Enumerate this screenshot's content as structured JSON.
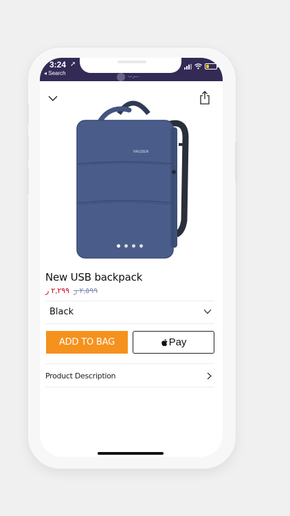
{
  "status_bar": {
    "time": "3:24",
    "back_label": "◂ Search",
    "brand_text": "ـــرب"
  },
  "product": {
    "title": "New USB backpack",
    "price_current": "٢,٢٩٩ ر",
    "price_original": "٢,٥٩٩ ر",
    "image_brand": "HAOZIER",
    "carousel": {
      "count": 4,
      "active_index": 0
    }
  },
  "options": {
    "color_selected": "Black"
  },
  "actions": {
    "add_to_bag_label": "ADD TO BAG",
    "apple_pay_label": "Pay"
  },
  "sections": {
    "product_description_label": "Product Description"
  },
  "colors": {
    "status_bar_bg": "#332b55",
    "add_to_bag_bg": "#f5921e",
    "price_current": "#d0021b",
    "price_original": "#7d8bb0",
    "backpack": "#4a5d8a"
  },
  "icons": [
    "chevron-down-icon",
    "share-icon",
    "chevron-down-icon",
    "apple-logo-icon",
    "chevron-right-icon"
  ]
}
